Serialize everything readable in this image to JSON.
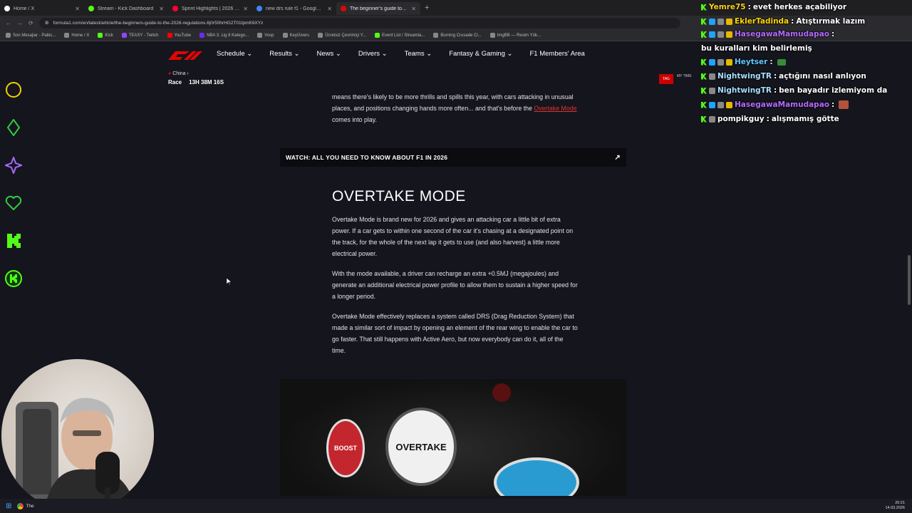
{
  "browser": {
    "tabs": [
      {
        "title": "Home / X",
        "color": "#ffffff",
        "active": false
      },
      {
        "title": "Stream - Kick Dashboard",
        "color": "#53fc18",
        "active": false
      },
      {
        "title": "Sprint Highlights | 2026 Chines...",
        "color": "#ff0033",
        "active": false
      },
      {
        "title": "new drs rule f1 - Google'da Ara",
        "color": "#4285f4",
        "active": false
      },
      {
        "title": "The beginner's guide to the 20...",
        "color": "#e10600",
        "active": true
      }
    ],
    "new_tab": "+",
    "url": "formula1.com/en/latest/article/the-beginners-guide-to-the-2026-regulations.6j0r50hrHG2T01tpmK6XYz",
    "bookmarks": [
      "Son Mesajlar - Pabic...",
      "Home / X",
      "Kick",
      "TEASY - Twitch",
      "YouTube",
      "NBA 3. Lig 8 Katego...",
      "Vosp",
      "KeyGivers",
      "Ücretsiz Çevrimiçi Y...",
      "Event List / Streamla...",
      "Burning Crusade Cl...",
      "ImgBB — Resim Yük..."
    ]
  },
  "f1": {
    "nav": [
      "Schedule",
      "Results",
      "News",
      "Drivers",
      "Teams",
      "Fantasy & Gaming",
      "F1 Members' Area"
    ],
    "race_location": "China",
    "race_label": "Race",
    "countdown": "13H 38M 16S",
    "sponsor": "TAG",
    "my_time": "MY TIME",
    "intro_text_1": "means there's likely to be more thrills and spills this year, with cars attacking in unusual places, and positions changing hands more often... and that's before the",
    "intro_link": "Overtake Mode",
    "intro_text_2": "comes into play.",
    "watch_label": "WATCH: ALL YOU NEED TO KNOW ABOUT F1 IN 2026",
    "heading": "OVERTAKE MODE",
    "para1": "Overtake Mode is brand new for 2026 and gives an attacking car a little bit of extra power. If a car gets to within one second of the car it's chasing at a designated point on the track, for the whole of the next lap it gets to use (and also harvest) a little more electrical power.",
    "para2": "With the mode available, a driver can recharge an extra +0.5MJ (megajoules) and generate an additional electrical power profile to allow them to sustain a higher speed for a longer period.",
    "para3": "Overtake Mode effectively replaces a system called DRS (Drag Reduction System) that made a similar sort of impact by opening an element of the rear wing to enable the car to go faster. That still happens with Active Aero, but now everybody can do it, all of the time.",
    "hero_boost": "BOOST",
    "hero_overtake": "OVERTAKE"
  },
  "chat": [
    {
      "user": "Yemre75",
      "color": "#ffd21f",
      "msg": "evet herkes açabiliyor"
    },
    {
      "user": "EklerTadinda",
      "color": "#ffd700",
      "msg": "Atıştırmak lazım"
    },
    {
      "user": "HasegawaMamudapao",
      "color": "#b36bff",
      "msg": "bu kuralları kim belirlemiş"
    },
    {
      "user": "Heytser",
      "color": "#5fc9ff",
      "msg": ""
    },
    {
      "user": "NightwingTR",
      "color": "#a8e0ff",
      "msg": "açtığını nasıl anlıyon"
    },
    {
      "user": "NightwingTR",
      "color": "#a8e0ff",
      "msg": "ben bayadır izlemiyom da"
    },
    {
      "user": "HasegawaMamudapao",
      "color": "#b36bff",
      "msg": ""
    },
    {
      "user": "pompikguy",
      "color": "#ffffff",
      "msg": "alışmamış götte"
    }
  ],
  "taskbar": {
    "app_label": "The",
    "time": "20:21",
    "date": "14.03.2026"
  },
  "colors": {
    "accent": "#e10600",
    "kick": "#53fc18",
    "bg": "#15151e"
  }
}
